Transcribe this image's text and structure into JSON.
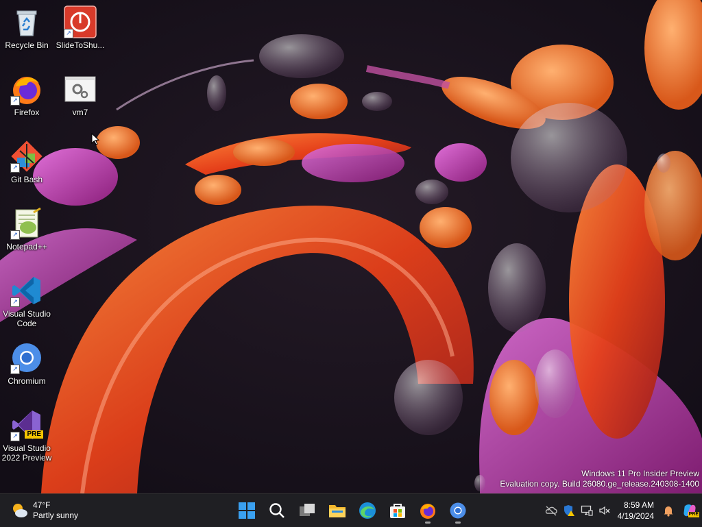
{
  "desktop": {
    "icons": [
      {
        "label": "Recycle Bin",
        "icon": "recycle-bin-icon"
      },
      {
        "label": "SlideToShu...",
        "icon": "slide-to-shutdown-icon"
      },
      {
        "label": "Firefox",
        "icon": "firefox-icon"
      },
      {
        "label": "vm7",
        "icon": "settings-window-icon"
      },
      {
        "label": "Git Bash",
        "icon": "git-bash-icon"
      },
      {
        "label": "Notepad++",
        "icon": "notepad-plus-plus-icon"
      },
      {
        "label": "Visual Studio Code",
        "icon": "vscode-icon"
      },
      {
        "label": "Chromium",
        "icon": "chromium-icon"
      },
      {
        "label": "Visual Studio 2022 Preview",
        "icon": "visual-studio-preview-icon",
        "badge": "PRE"
      }
    ],
    "shortcut_arrow": "↗"
  },
  "watermark": {
    "line1": "Windows 11 Pro Insider Preview",
    "line2": "Evaluation copy. Build 26080.ge_release.240308-1400"
  },
  "taskbar": {
    "weather": {
      "temp": "47°F",
      "condition": "Partly sunny"
    },
    "pinned": [
      "start-icon",
      "search-icon",
      "task-view-icon",
      "file-explorer-icon",
      "edge-icon",
      "store-icon",
      "firefox-icon",
      "chromium-icon"
    ],
    "clock": {
      "time": "8:59 AM",
      "date": "4/19/2024"
    },
    "copilot_badge": "PRE"
  },
  "colors": {
    "taskbar_bg": "#1f1f23",
    "accent": "#0078d4"
  }
}
